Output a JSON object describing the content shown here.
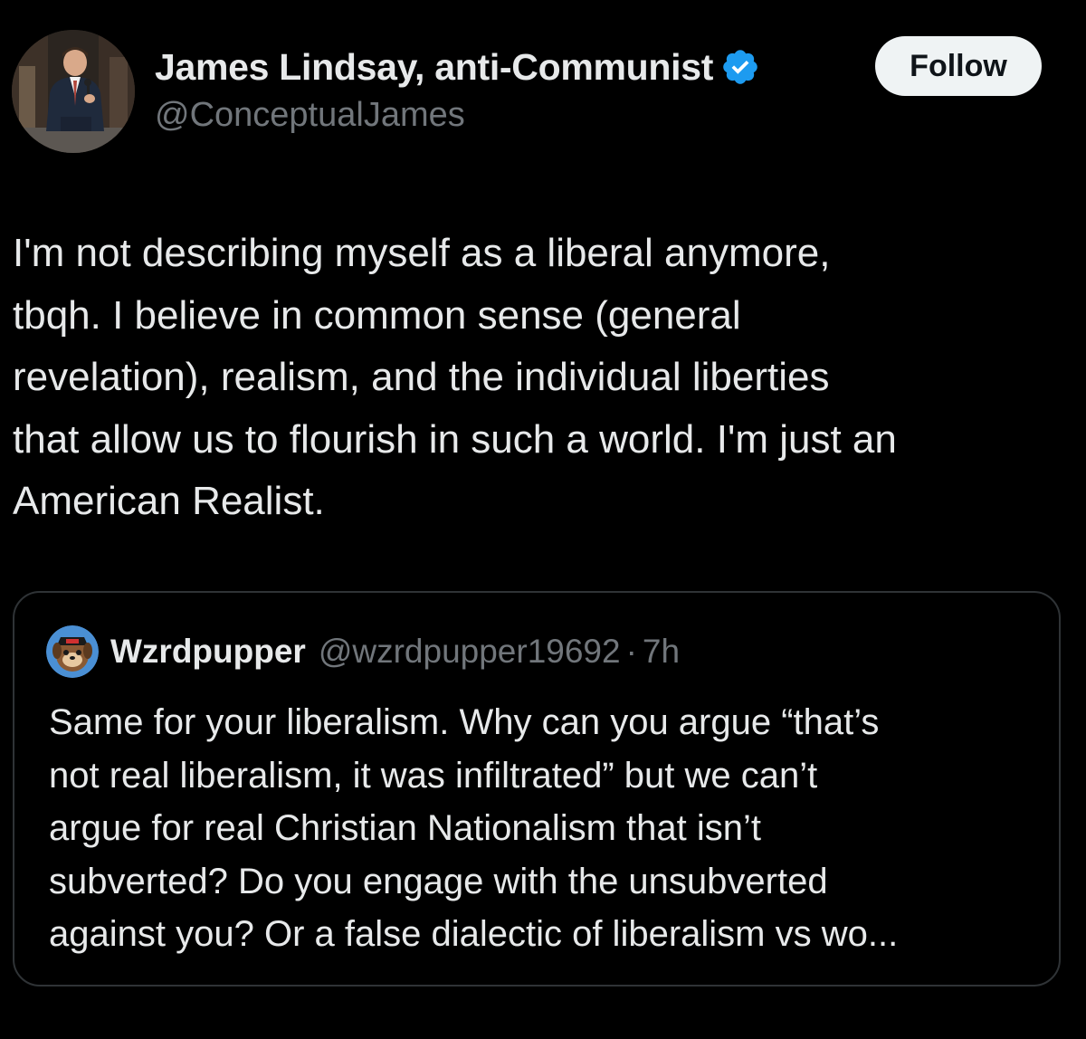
{
  "tweet": {
    "author": {
      "display_name": "James Lindsay, anti-Communist",
      "handle": "@ConceptualJames",
      "avatar_icon": "profile-photo",
      "verified_icon": "verified-badge-icon"
    },
    "follow_label": "Follow",
    "text": "I'm not describing myself as a liberal anymore,\ntbqh. I believe in common sense (general\nrevelation), realism, and the individual liberties\nthat allow us to flourish in such a world. I'm just an\nAmerican Realist."
  },
  "quoted_tweet": {
    "display_name": "Wzrdpupper",
    "handle": "@wzrdpupper19692",
    "separator": "·",
    "time": "7h",
    "avatar_icon": "cartoon-dog-avatar",
    "text": "Same for your liberalism. Why can you argue “that’s\nnot real liberalism, it was infiltrated” but we can’t\nargue for real Christian Nationalism that isn’t\nsubverted? Do you engage with the unsubverted\nagainst you? Or  a false dialectic of liberalism vs wo..."
  },
  "colors": {
    "background": "#000000",
    "primary_text": "#e7e9ea",
    "secondary_text": "#71767b",
    "verified_blue": "#1d9bf0",
    "follow_bg": "#eff3f4",
    "border": "#2f3336"
  }
}
